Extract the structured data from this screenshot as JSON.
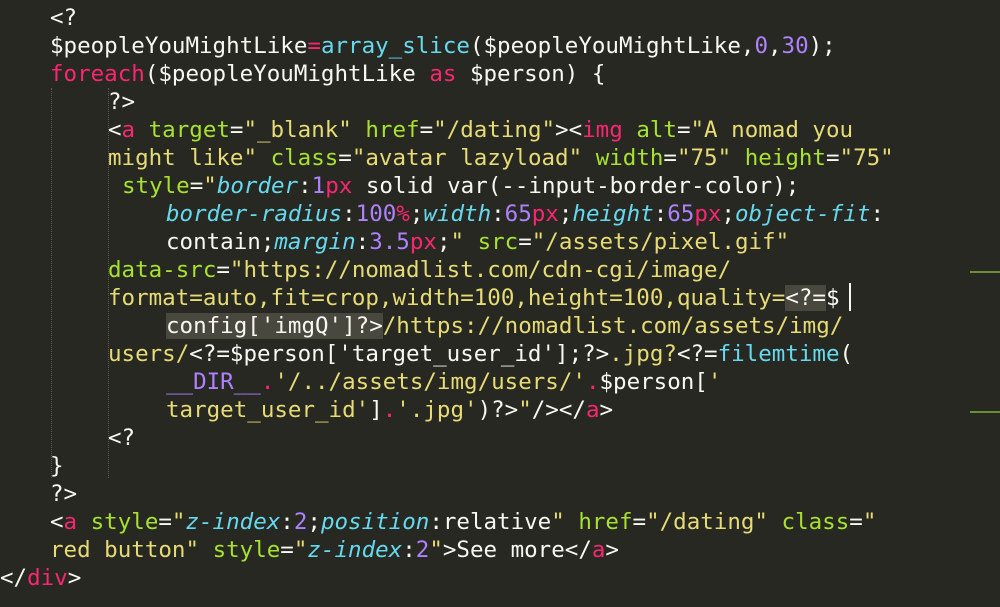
{
  "theme": {
    "background": "#272822",
    "text": "#f8f8f2",
    "keyword": "#f92672",
    "function": "#a6e22e",
    "string": "#e6db74",
    "property": "#66d9ef",
    "number": "#ae81ff"
  },
  "code": {
    "line01": [
      {
        "c": "w",
        "t": "<?"
      }
    ],
    "line02": [
      {
        "c": "w",
        "t": "$peopleYouMightLike"
      },
      {
        "c": "pk",
        "t": "="
      },
      {
        "c": "cyn",
        "t": "array_slice"
      },
      {
        "c": "w",
        "t": "($peopleYouMightLike,"
      },
      {
        "c": "pu",
        "t": "0"
      },
      {
        "c": "w",
        "t": ","
      },
      {
        "c": "pu",
        "t": "30"
      },
      {
        "c": "w",
        "t": ");"
      }
    ],
    "line03": [
      {
        "c": "pk",
        "t": "foreach"
      },
      {
        "c": "w",
        "t": "($peopleYouMightLike "
      },
      {
        "c": "pk",
        "t": "as"
      },
      {
        "c": "w",
        "t": " $person) {"
      }
    ],
    "line04": [
      {
        "c": "w",
        "t": "?>"
      }
    ],
    "line05": [
      {
        "c": "w",
        "t": "<"
      },
      {
        "c": "pk",
        "t": "a"
      },
      {
        "c": "w",
        "t": " "
      },
      {
        "c": "gr",
        "t": "target"
      },
      {
        "c": "w",
        "t": "="
      },
      {
        "c": "yl",
        "t": "\"_blank\""
      },
      {
        "c": "w",
        "t": " "
      },
      {
        "c": "gr",
        "t": "href"
      },
      {
        "c": "w",
        "t": "="
      },
      {
        "c": "yl",
        "t": "\"/dating\""
      },
      {
        "c": "w",
        "t": "><"
      },
      {
        "c": "pk",
        "t": "img"
      },
      {
        "c": "w",
        "t": " "
      },
      {
        "c": "gr",
        "t": "alt"
      },
      {
        "c": "w",
        "t": "="
      },
      {
        "c": "yl",
        "t": "\"A nomad you"
      }
    ],
    "line06": [
      {
        "c": "yl",
        "t": "might like\""
      },
      {
        "c": "w",
        "t": " "
      },
      {
        "c": "gr",
        "t": "class"
      },
      {
        "c": "w",
        "t": "="
      },
      {
        "c": "yl",
        "t": "\"avatar lazyload\""
      },
      {
        "c": "w",
        "t": " "
      },
      {
        "c": "gr",
        "t": "width"
      },
      {
        "c": "w",
        "t": "="
      },
      {
        "c": "yl",
        "t": "\"75\""
      },
      {
        "c": "w",
        "t": " "
      },
      {
        "c": "gr",
        "t": "height"
      },
      {
        "c": "w",
        "t": "="
      },
      {
        "c": "yl",
        "t": "\"75\""
      }
    ],
    "line07": [
      {
        "c": "gr",
        "t": "style"
      },
      {
        "c": "w",
        "t": "="
      },
      {
        "c": "yl",
        "t": "\""
      },
      {
        "c": "cy",
        "t": "border"
      },
      {
        "c": "w",
        "t": ":"
      },
      {
        "c": "pu",
        "t": "1"
      },
      {
        "c": "pk",
        "t": "px"
      },
      {
        "c": "w",
        "t": " solid var(--input-border-color);"
      }
    ],
    "line08": [
      {
        "c": "cy",
        "t": "border-radius"
      },
      {
        "c": "w",
        "t": ":"
      },
      {
        "c": "pu",
        "t": "100"
      },
      {
        "c": "pk",
        "t": "%"
      },
      {
        "c": "w",
        "t": ";"
      },
      {
        "c": "cy",
        "t": "width"
      },
      {
        "c": "w",
        "t": ":"
      },
      {
        "c": "pu",
        "t": "65"
      },
      {
        "c": "pk",
        "t": "px"
      },
      {
        "c": "w",
        "t": ";"
      },
      {
        "c": "cy",
        "t": "height"
      },
      {
        "c": "w",
        "t": ":"
      },
      {
        "c": "pu",
        "t": "65"
      },
      {
        "c": "pk",
        "t": "px"
      },
      {
        "c": "w",
        "t": ";"
      },
      {
        "c": "cy",
        "t": "object-fit"
      },
      {
        "c": "w",
        "t": ":"
      }
    ],
    "line09": [
      {
        "c": "w",
        "t": "contain;"
      },
      {
        "c": "cy",
        "t": "margin"
      },
      {
        "c": "w",
        "t": ":"
      },
      {
        "c": "pu",
        "t": "3.5"
      },
      {
        "c": "pk",
        "t": "px"
      },
      {
        "c": "w",
        "t": ";"
      },
      {
        "c": "yl",
        "t": "\""
      },
      {
        "c": "w",
        "t": " "
      },
      {
        "c": "gr",
        "t": "src"
      },
      {
        "c": "w",
        "t": "="
      },
      {
        "c": "yl",
        "t": "\"/assets/pixel.gif\""
      }
    ],
    "line10": [
      {
        "c": "gr",
        "t": "data-src"
      },
      {
        "c": "w",
        "t": "="
      },
      {
        "c": "yl",
        "t": "\"https://nomadlist.com/cdn-cgi/image/"
      }
    ],
    "line11": [
      {
        "c": "yl",
        "t": "format=auto,fit=crop,width=100,height=100,quality="
      },
      {
        "c": "w hl",
        "t": "<?="
      },
      {
        "c": "w",
        "t": "$"
      }
    ],
    "line12": [
      {
        "c": "w hl",
        "t": "config['imgQ']?>"
      },
      {
        "c": "yl",
        "t": "/https://nomadlist.com/assets/img/"
      }
    ],
    "line13": [
      {
        "c": "yl",
        "t": "users/"
      },
      {
        "c": "w",
        "t": "<?=$person['target_user_id'];?>"
      },
      {
        "c": "yl",
        "t": ".jpg?"
      },
      {
        "c": "w",
        "t": "<?="
      },
      {
        "c": "cyn",
        "t": "filemtime"
      },
      {
        "c": "w",
        "t": "("
      }
    ],
    "line14": [
      {
        "c": "pu",
        "t": "__DIR__"
      },
      {
        "c": "pk",
        "t": "."
      },
      {
        "c": "yl",
        "t": "'/../assets/img/users/'"
      },
      {
        "c": "pk",
        "t": "."
      },
      {
        "c": "w",
        "t": "$person["
      },
      {
        "c": "yl",
        "t": "'"
      }
    ],
    "line15": [
      {
        "c": "yl",
        "t": "target_user_id'"
      },
      {
        "c": "w",
        "t": "]"
      },
      {
        "c": "pk",
        "t": "."
      },
      {
        "c": "yl",
        "t": "'.jpg'"
      },
      {
        "c": "w",
        "t": ")?>"
      },
      {
        "c": "yl",
        "t": "\""
      },
      {
        "c": "w",
        "t": "/></"
      },
      {
        "c": "pk",
        "t": "a"
      },
      {
        "c": "w",
        "t": ">"
      }
    ],
    "line16": [
      {
        "c": "w",
        "t": "<?"
      }
    ],
    "line17": [
      {
        "c": "w",
        "t": "}"
      }
    ],
    "line18": [
      {
        "c": "w",
        "t": "?>"
      }
    ],
    "line19": [
      {
        "c": "w",
        "t": "<"
      },
      {
        "c": "pk",
        "t": "a"
      },
      {
        "c": "w",
        "t": " "
      },
      {
        "c": "gr",
        "t": "style"
      },
      {
        "c": "w",
        "t": "="
      },
      {
        "c": "yl",
        "t": "\""
      },
      {
        "c": "cy",
        "t": "z-index"
      },
      {
        "c": "w",
        "t": ":"
      },
      {
        "c": "pu",
        "t": "2"
      },
      {
        "c": "w",
        "t": ";"
      },
      {
        "c": "cy",
        "t": "position"
      },
      {
        "c": "w",
        "t": ":relative"
      },
      {
        "c": "yl",
        "t": "\""
      },
      {
        "c": "w",
        "t": " "
      },
      {
        "c": "gr",
        "t": "href"
      },
      {
        "c": "w",
        "t": "="
      },
      {
        "c": "yl",
        "t": "\"/dating\""
      },
      {
        "c": "w",
        "t": " "
      },
      {
        "c": "gr",
        "t": "class"
      },
      {
        "c": "w",
        "t": "="
      },
      {
        "c": "yl",
        "t": "\""
      }
    ],
    "line20": [
      {
        "c": "yl",
        "t": "red button\""
      },
      {
        "c": "w",
        "t": " "
      },
      {
        "c": "gr",
        "t": "style"
      },
      {
        "c": "w",
        "t": "="
      },
      {
        "c": "yl",
        "t": "\""
      },
      {
        "c": "cy",
        "t": "z-index"
      },
      {
        "c": "w",
        "t": ":"
      },
      {
        "c": "pu",
        "t": "2"
      },
      {
        "c": "yl",
        "t": "\""
      },
      {
        "c": "w",
        "t": ">See more</"
      },
      {
        "c": "pk",
        "t": "a"
      },
      {
        "c": "w",
        "t": ">"
      }
    ],
    "line21": [
      {
        "c": "w",
        "t": "</"
      },
      {
        "c": "pk",
        "t": "div"
      },
      {
        "c": "w",
        "t": ">"
      }
    ]
  }
}
